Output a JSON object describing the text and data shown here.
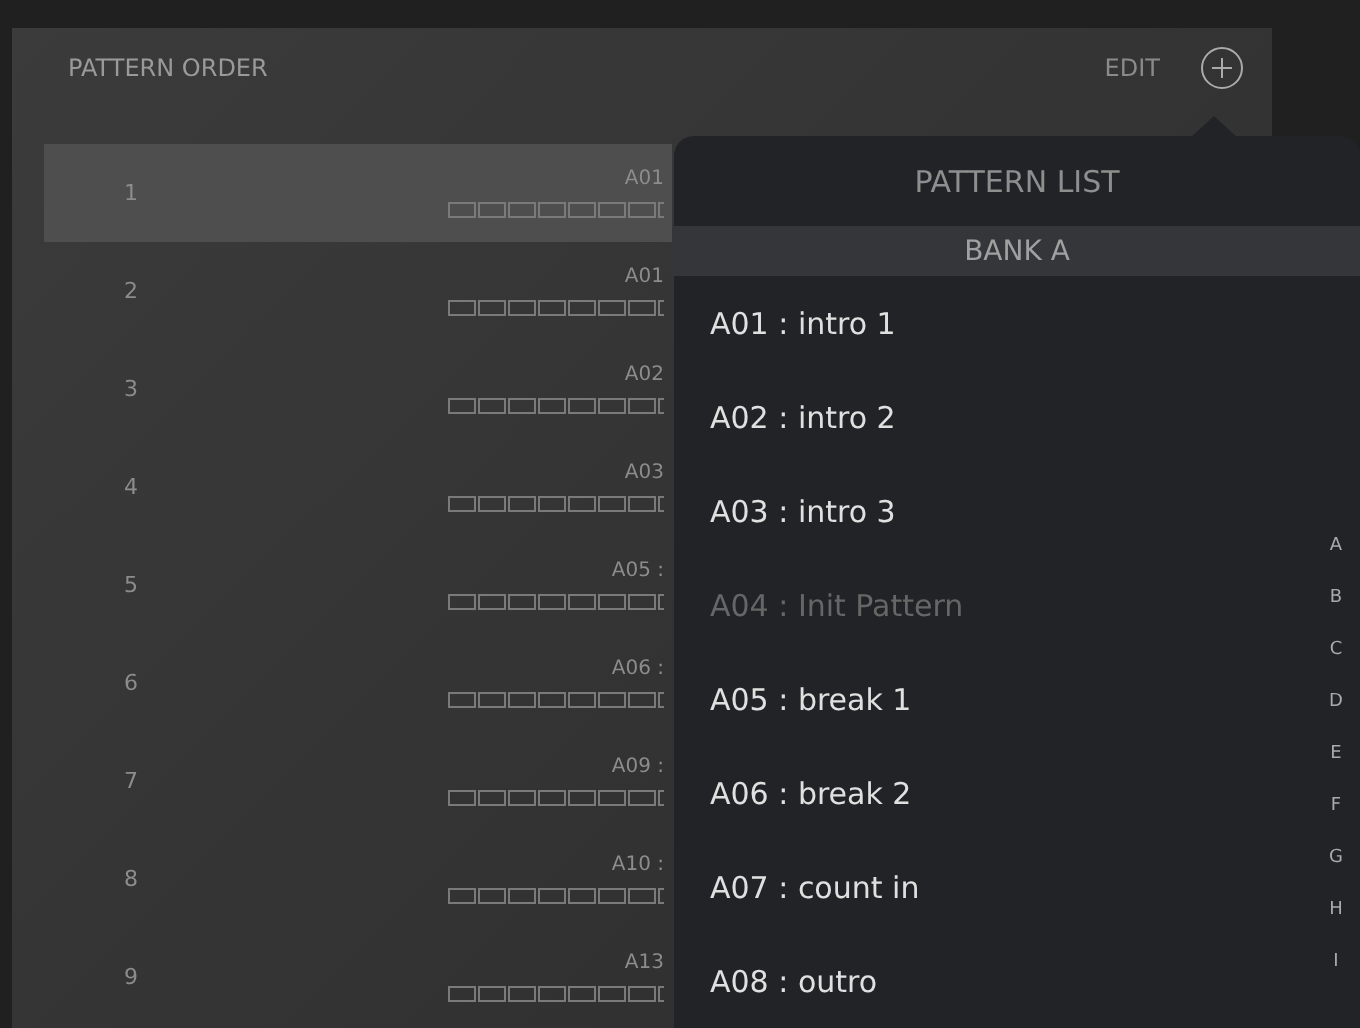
{
  "header": {
    "title": "PATTERN ORDER",
    "edit": "EDIT"
  },
  "rows": [
    {
      "number": "1",
      "pattern": "A01",
      "selected": true
    },
    {
      "number": "2",
      "pattern": "A01",
      "selected": false
    },
    {
      "number": "3",
      "pattern": "A02",
      "selected": false
    },
    {
      "number": "4",
      "pattern": "A03",
      "selected": false
    },
    {
      "number": "5",
      "pattern": "A05 :",
      "selected": false
    },
    {
      "number": "6",
      "pattern": "A06 :",
      "selected": false
    },
    {
      "number": "7",
      "pattern": "A09 :",
      "selected": false
    },
    {
      "number": "8",
      "pattern": "A10 :",
      "selected": false
    },
    {
      "number": "9",
      "pattern": "A13",
      "selected": false
    }
  ],
  "popover": {
    "title": "PATTERN LIST",
    "section": "BANK A",
    "items": [
      {
        "label": "A01 : intro 1",
        "disabled": false
      },
      {
        "label": "A02 : intro 2",
        "disabled": false
      },
      {
        "label": "A03 : intro 3",
        "disabled": false
      },
      {
        "label": "A04 : Init Pattern",
        "disabled": true
      },
      {
        "label": "A05 : break 1",
        "disabled": false
      },
      {
        "label": "A06 : break 2",
        "disabled": false
      },
      {
        "label": "A07 : count in",
        "disabled": false
      },
      {
        "label": "A08 : outro",
        "disabled": false
      }
    ],
    "index": [
      "A",
      "B",
      "C",
      "D",
      "E",
      "F",
      "G",
      "H",
      "I"
    ]
  }
}
